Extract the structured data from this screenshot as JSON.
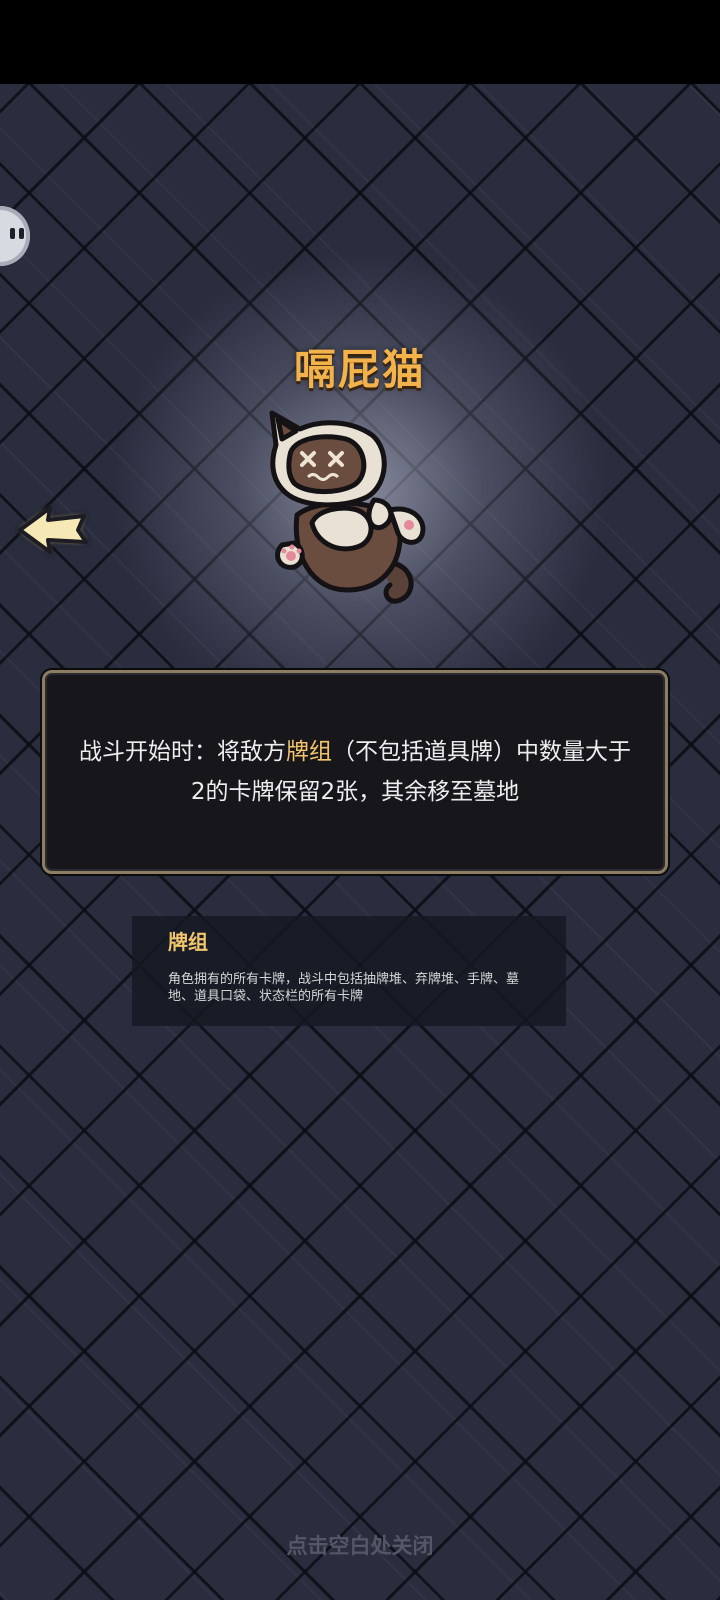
{
  "relic": {
    "name": "嗝屁猫",
    "description_before": "战斗开始时：将敌方",
    "description_keyword": "牌组",
    "description_after": "（不包括道具牌）中数量大于2的卡牌保留2张，其余移至墓地"
  },
  "keyword": {
    "title": "牌组",
    "description": "角色拥有的所有卡牌，战斗中包括抽牌堆、弃牌堆、手牌、墓地、道具口袋、状态栏的所有卡牌"
  },
  "close_hint": "点击空白处关闭",
  "icons": {
    "back": "back-arrow-icon",
    "float": "floating-assistant-icon",
    "relic": "dead-cat-icon"
  },
  "colors": {
    "title": "#f3b34a",
    "keyword": "#f3c56c",
    "frame": "#8d7d62"
  }
}
